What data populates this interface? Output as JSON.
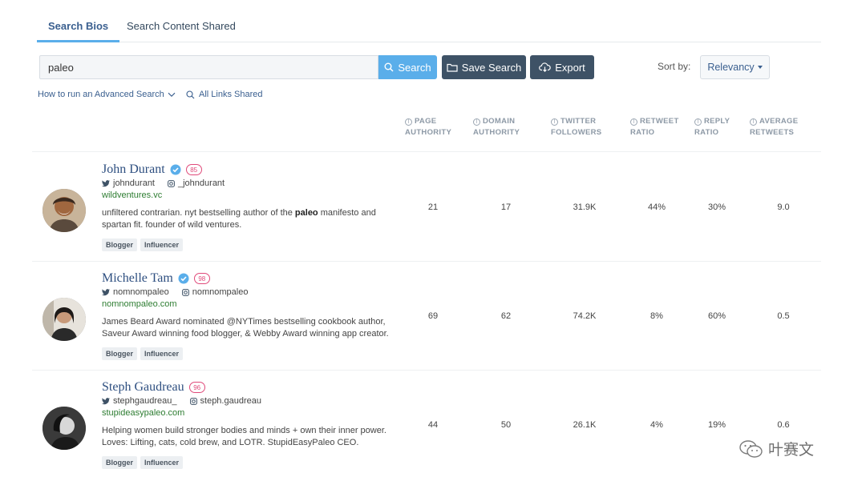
{
  "tabs": [
    {
      "label": "Search Bios",
      "active": true
    },
    {
      "label": "Search Content Shared",
      "active": false
    }
  ],
  "search": {
    "value": "paleo",
    "button_label": "Search"
  },
  "toolbar": {
    "save_label": "Save Search",
    "export_label": "Export"
  },
  "sort": {
    "label": "Sort by:",
    "selected": "Relevancy"
  },
  "links": {
    "advanced": "How to run an Advanced Search",
    "all_links": "All Links Shared"
  },
  "columns": [
    {
      "line1": "PAGE",
      "line2": "AUTHORITY"
    },
    {
      "line1": "DOMAIN",
      "line2": "AUTHORITY"
    },
    {
      "line1": "TWITTER",
      "line2": "FOLLOWERS"
    },
    {
      "line1": "RETWEET",
      "line2": "RATIO"
    },
    {
      "line1": "REPLY",
      "line2": "RATIO"
    },
    {
      "line1": "AVERAGE",
      "line2": "RETWEETS"
    }
  ],
  "results": [
    {
      "name": "John Durant",
      "verified": true,
      "score": "85",
      "twitter": "johndurant",
      "instagram": "_johndurant",
      "website": "wildventures.vc",
      "bio_before": "unfiltered contrarian. nyt bestselling author of the ",
      "bio_bold": "paleo",
      "bio_after": " manifesto and spartan fit. founder of wild ventures.",
      "tags": [
        "Blogger",
        "Influencer"
      ],
      "metrics": [
        "21",
        "17",
        "31.9K",
        "44%",
        "30%",
        "9.0"
      ]
    },
    {
      "name": "Michelle Tam",
      "verified": true,
      "score": "98",
      "twitter": "nomnompaleo",
      "instagram": "nomnompaleo",
      "website": "nomnompaleo.com",
      "bio_before": "James Beard Award nominated @NYTimes bestselling cookbook author, Saveur Award winning food blogger, & Webby Award winning app creator.",
      "bio_bold": "",
      "bio_after": "",
      "tags": [
        "Blogger",
        "Influencer"
      ],
      "metrics": [
        "69",
        "62",
        "74.2K",
        "8%",
        "60%",
        "0.5"
      ]
    },
    {
      "name": "Steph Gaudreau",
      "verified": false,
      "score": "96",
      "twitter": "stephgaudreau_",
      "instagram": "steph.gaudreau",
      "website": "stupideasypaleo.com",
      "bio_before": "Helping women build stronger bodies and minds + own their inner power. Loves: Lifting, cats, cold brew, and LOTR. StupidEasyPaleo CEO.",
      "bio_bold": "",
      "bio_after": "",
      "tags": [
        "Blogger",
        "Influencer"
      ],
      "metrics": [
        "44",
        "50",
        "26.1K",
        "4%",
        "19%",
        "0.6"
      ]
    }
  ],
  "watermark": {
    "text": "叶赛文"
  },
  "icons": {
    "search": "search-icon",
    "save": "folder-icon",
    "export": "cloud-download-icon",
    "twitter": "twitter-icon",
    "instagram": "instagram-icon",
    "verified": "verified-badge-icon",
    "info": "info-icon"
  },
  "colors": {
    "accent": "#5aaeea",
    "dark_button": "#3e5266",
    "link": "#3a5f8f",
    "name": "#2e4f80",
    "website": "#2e7d32",
    "score": "#e04a7a"
  }
}
